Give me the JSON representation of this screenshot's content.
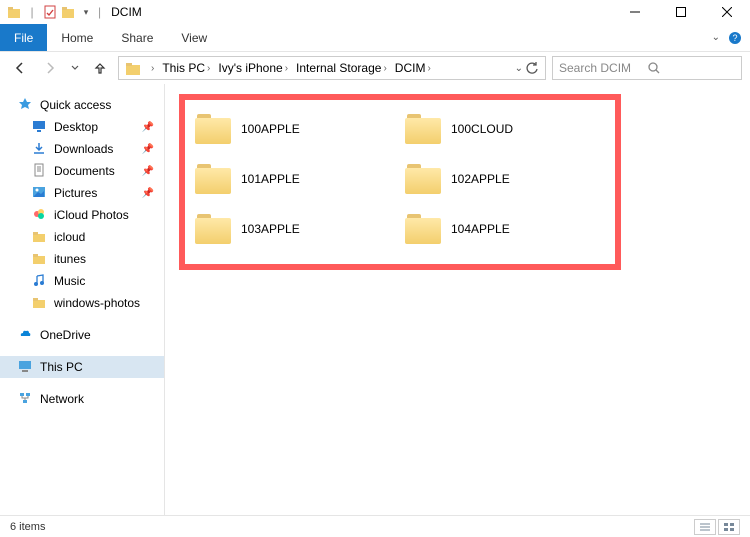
{
  "window": {
    "title": "DCIM"
  },
  "ribbon": {
    "file": "File",
    "tabs": [
      "Home",
      "Share",
      "View"
    ]
  },
  "breadcrumb": {
    "segments": [
      "This PC",
      "Ivy's iPhone",
      "Internal Storage",
      "DCIM"
    ]
  },
  "search": {
    "placeholder": "Search DCIM"
  },
  "sidebar": {
    "quick_access": {
      "label": "Quick access",
      "items": [
        {
          "label": "Desktop",
          "pinned": true,
          "icon": "desktop"
        },
        {
          "label": "Downloads",
          "pinned": true,
          "icon": "downloads"
        },
        {
          "label": "Documents",
          "pinned": true,
          "icon": "documents"
        },
        {
          "label": "Pictures",
          "pinned": true,
          "icon": "pictures"
        },
        {
          "label": "iCloud Photos",
          "pinned": false,
          "icon": "icloud-photos"
        },
        {
          "label": "icloud",
          "pinned": false,
          "icon": "folder"
        },
        {
          "label": "itunes",
          "pinned": false,
          "icon": "folder"
        },
        {
          "label": "Music",
          "pinned": false,
          "icon": "music"
        },
        {
          "label": "windows-photos",
          "pinned": false,
          "icon": "folder"
        }
      ]
    },
    "onedrive": {
      "label": "OneDrive"
    },
    "this_pc": {
      "label": "This PC"
    },
    "network": {
      "label": "Network"
    }
  },
  "folders": [
    {
      "name": "100APPLE"
    },
    {
      "name": "100CLOUD"
    },
    {
      "name": "101APPLE"
    },
    {
      "name": "102APPLE"
    },
    {
      "name": "103APPLE"
    },
    {
      "name": "104APPLE"
    }
  ],
  "status": {
    "item_count": "6 items"
  }
}
